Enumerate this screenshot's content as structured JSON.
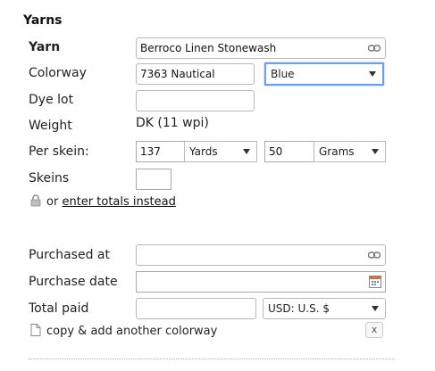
{
  "section": {
    "title": "Yarns"
  },
  "yarn": {
    "label": "Yarn",
    "value": "Berroco Linen Stonewash"
  },
  "colorway": {
    "label": "Colorway",
    "value": "7363 Nautical",
    "color_select": "Blue"
  },
  "dye_lot": {
    "label": "Dye lot",
    "value": ""
  },
  "weight": {
    "label": "Weight",
    "value": "DK (11 wpi)"
  },
  "per_skein": {
    "label": "Per skein:",
    "length_value": "137",
    "length_unit": "Yards",
    "mass_value": "50",
    "mass_unit": "Grams"
  },
  "skeins": {
    "label": "Skeins",
    "value": ""
  },
  "totals": {
    "prefix": "or",
    "link_text": "enter totals instead"
  },
  "purchased_at": {
    "label": "Purchased at",
    "value": ""
  },
  "purchase_date": {
    "label": "Purchase date",
    "value": ""
  },
  "total_paid": {
    "label": "Total paid",
    "value": "",
    "currency": "USD: U.S. $"
  },
  "copy": {
    "text": "copy & add another colorway",
    "close_label": "x"
  },
  "colors": {
    "focus_border": "#6a9ff0",
    "field_border": "#b8b8b8",
    "link": "#111111"
  }
}
